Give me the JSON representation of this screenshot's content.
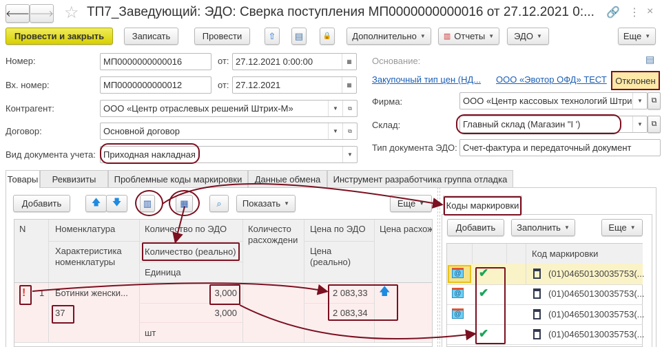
{
  "window": {
    "title": "ТП7_Заведующий: ЭДО: Сверка поступления МП0000000000016 от 27.12.2021 0:...",
    "back_icon": "arrow-left",
    "forward_icon": "arrow-right",
    "star_icon": "star",
    "link_icon": "link",
    "menu_icon": "kebab",
    "close_icon": "×"
  },
  "toolbar": {
    "post_close": "Провести и закрыть",
    "save": "Записать",
    "post": "Провести",
    "more_actions": "Дополнительно",
    "reports": "Отчеты",
    "edo": "ЭДО",
    "more": "Еще"
  },
  "form": {
    "number_label": "Номер:",
    "number": "МП0000000000016",
    "from_label": "от:",
    "date": "27.12.2021  0:00:00",
    "in_number_label": "Вх. номер:",
    "in_number": "МП0000000000012",
    "in_date": "27.12.2021",
    "counterparty_label": "Контрагент:",
    "counterparty": "ООО «Центр отраслевых решений Штрих-М»",
    "contract_label": "Договор:",
    "contract": "Основной договор",
    "doc_kind_label": "Вид документа учета:",
    "doc_kind": "Приходная накладная",
    "basis_label": "Основание:",
    "price_type_link": "Закупочный тип цен (НД...",
    "operator_link": "ООО «Эвотор ОФД» ТЕСТ",
    "status": "Отклонен",
    "firm_label": "Фирма:",
    "firm": "ООО «Центр кассовых технологий Штри",
    "warehouse_label": "Склад:",
    "warehouse": "Главный склад (Магазин \"I                ')",
    "edo_type_label": "Тип документа ЭДО:",
    "edo_type": "Счет-фактура и передаточный документ"
  },
  "tabs": [
    "Товары",
    "Реквизиты",
    "Проблемные коды маркировки",
    "Данные обмена",
    "Инструмент разработчика группа отладка"
  ],
  "goods": {
    "add": "Добавить",
    "show": "Показать",
    "more": "Еще",
    "headers": {
      "n": "N",
      "nom": "Номенклатура",
      "char": "Характеристика номенклатуры",
      "qty_edo": "Количество по ЭДО",
      "qty_real": "Количество (реально)",
      "unit": "Единица",
      "qty_diff": "Количесто расхождени",
      "price_edo": "Цена по ЭДО",
      "price_real": "Цена (реально)",
      "price_diff": "Цена расхож"
    },
    "rows": [
      {
        "warn": "!",
        "n": "1",
        "nom": "Ботинки женски...",
        "char": "37",
        "qty_edo": "3,000",
        "qty_real": "3,000",
        "unit": "шт",
        "price_edo": "2 083,33",
        "price_real": "2 083,34",
        "price_diff_icon": "arrow-up"
      }
    ]
  },
  "codes": {
    "tab": "Коды маркировки",
    "add": "Добавить",
    "fill": "Заполнить",
    "more": "Еще",
    "header": "Код маркировки",
    "rows": [
      {
        "edo_icon": true,
        "check": true,
        "code": "(01)04650130035753(...",
        "selected": true
      },
      {
        "edo_icon": true,
        "check": true,
        "code": "(01)04650130035753(..."
      },
      {
        "edo_icon": true,
        "check": false,
        "code": "(01)04650130035753(..."
      },
      {
        "edo_icon": false,
        "check": true,
        "code": "(01)04650130035753(..."
      }
    ]
  },
  "colors": {
    "accent": "#d7d000",
    "annotation": "#7a1020",
    "row_error": "#fdeeee",
    "selected_row": "#fbf3c8",
    "link": "#1c5fb5",
    "check": "#1aa55a"
  }
}
